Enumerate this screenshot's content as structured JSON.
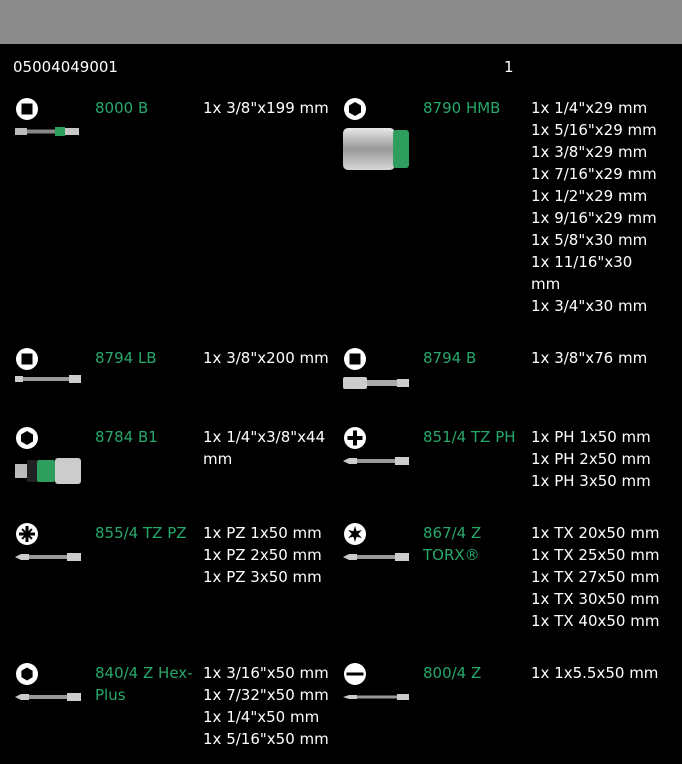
{
  "header": {
    "article_number": "05004049001",
    "quantity": "1"
  },
  "items": [
    {
      "code": "8000 B",
      "icon": "square-drive-icon",
      "lines": [
        "1x 3/8\"x199 mm"
      ]
    },
    {
      "code": "8790 HMB",
      "icon": "hexagon-socket-icon",
      "lines": [
        "1x 1/4\"x29 mm",
        "1x 5/16\"x29 mm",
        "1x 3/8\"x29 mm",
        "1x 7/16\"x29 mm",
        "1x 1/2\"x29 mm",
        "1x 9/16\"x29 mm",
        "1x 5/8\"x30 mm",
        "1x 11/16\"x30",
        "mm",
        "1x 3/4\"x30 mm"
      ]
    },
    {
      "code": "8794 LB",
      "icon": "square-drive-icon",
      "lines": [
        "1x 3/8\"x200 mm"
      ]
    },
    {
      "code": "8794 B",
      "icon": "square-drive-icon",
      "lines": [
        "1x 3/8\"x76 mm"
      ]
    },
    {
      "code": "8784 B1",
      "icon": "hexagon-socket-icon",
      "lines": [
        "1x 1/4\"x3/8\"x44",
        "mm"
      ]
    },
    {
      "code": "851/4 TZ PH",
      "icon": "phillips-icon",
      "lines": [
        "1x PH 1x50 mm",
        "1x PH 2x50 mm",
        "1x PH 3x50 mm"
      ]
    },
    {
      "code": "855/4 TZ PZ",
      "icon": "pozidriv-icon",
      "lines": [
        "1x PZ 1x50 mm",
        "1x PZ 2x50 mm",
        "1x PZ 3x50 mm"
      ]
    },
    {
      "code": "867/4 Z TORX®",
      "code_lines": [
        "867/4 Z",
        "TORX®"
      ],
      "icon": "torx-icon",
      "lines": [
        "1x TX 20x50 mm",
        "1x TX 25x50 mm",
        "1x TX 27x50 mm",
        "1x TX 30x50 mm",
        "1x TX 40x50 mm"
      ]
    },
    {
      "code": "840/4 Z Hex-Plus",
      "code_lines": [
        "840/4 Z Hex-",
        "Plus"
      ],
      "icon": "hex-plus-icon",
      "lines": [
        "1x 3/16\"x50 mm",
        "1x 7/32\"x50 mm",
        "1x 1/4\"x50 mm",
        "1x 5/16\"x50 mm"
      ]
    },
    {
      "code": "800/4 Z",
      "icon": "slotted-icon",
      "lines": [
        "1x 1x5.5x50 mm"
      ]
    }
  ],
  "colors": {
    "accent": "#28a86a",
    "background": "#000000",
    "topbar": "#8c8c8c",
    "text": "#ffffff"
  }
}
